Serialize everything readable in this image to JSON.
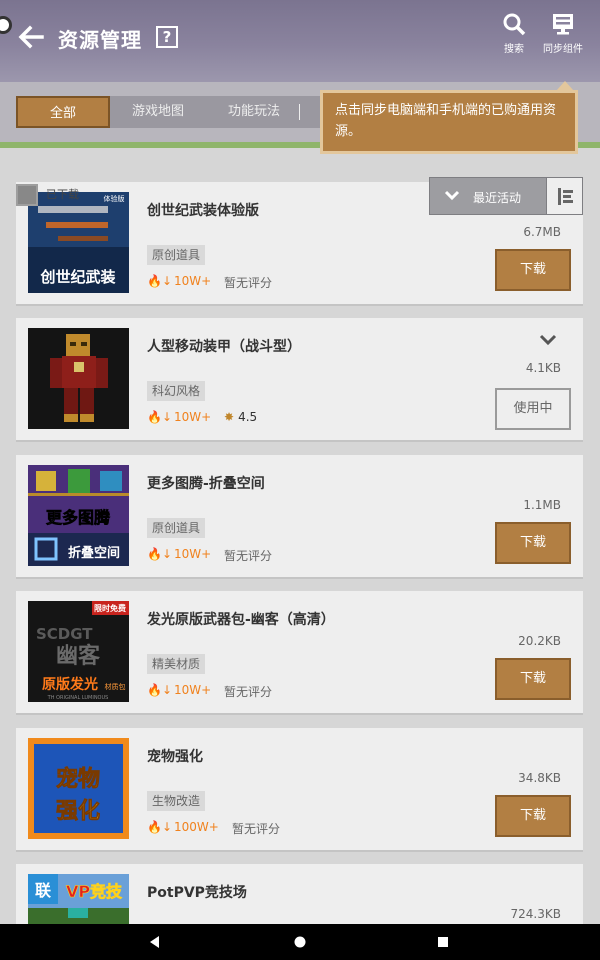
{
  "header": {
    "title": "资源管理",
    "help": "?",
    "search_label": "搜索",
    "sync_label": "同步组件"
  },
  "tabs": [
    {
      "label": "全部",
      "active": true
    },
    {
      "label": "游戏地图",
      "active": false
    },
    {
      "label": "功能玩法",
      "active": false
    }
  ],
  "tooltip": {
    "text": "点击同步电脑端和手机端的已购通用资源。"
  },
  "selection": {
    "label": "已下载"
  },
  "sort": {
    "label": "最近活动"
  },
  "items": [
    {
      "name": "创世纪武装体验版",
      "tag": "原创道具",
      "downloads": "10W+",
      "rating": "暂无评分",
      "size": "6.7MB",
      "action": "下载",
      "thumb_text": "创世纪武装",
      "thumb_badge": "体验版"
    },
    {
      "name": "人型移动装甲（战斗型）",
      "tag": "科幻风格",
      "downloads": "10W+",
      "rating": "4.5",
      "size": "4.1KB",
      "action": "使用中"
    },
    {
      "name": "更多图腾-折叠空间",
      "tag": "原创道具",
      "downloads": "10W+",
      "rating": "暂无评分",
      "size": "1.1MB",
      "action": "下载",
      "thumb_text": "更多图腾",
      "thumb_text2": "折叠空间"
    },
    {
      "name": "发光原版武器包-幽客（高清）",
      "tag": "精美材质",
      "downloads": "10W+",
      "rating": "暂无评分",
      "size": "20.2KB",
      "action": "下载",
      "thumb_badge": "限时免费",
      "thumb_text": "幽客",
      "thumb_text2": "原版发光",
      "thumb_sub": "SCDGT",
      "thumb_small": "材质包",
      "thumb_tiny": "TH ORIGINAL LUMINOUS"
    },
    {
      "name": "宠物强化",
      "tag": "生物改造",
      "downloads": "100W+",
      "rating": "暂无评分",
      "size": "34.8KB",
      "action": "下载",
      "thumb_text": "宠物",
      "thumb_text2": "强化"
    },
    {
      "name": "PotPVP竞技场",
      "size": "724.3KB",
      "thumb_text": "VP竞技",
      "thumb_badge": "联"
    }
  ],
  "colors": {
    "header": "#8a839e",
    "accent_brown": "#b27f43",
    "hot_orange": "#f0821e",
    "card_bg": "#eeeeee",
    "list_bg": "#d6d6d6"
  },
  "icons": [
    "back-arrow-icon",
    "help-icon",
    "search-icon",
    "sync-monitor-icon",
    "flame-download-icon",
    "star-rating-icon",
    "chevron-down-icon",
    "sort-icon",
    "checkbox-icon"
  ]
}
